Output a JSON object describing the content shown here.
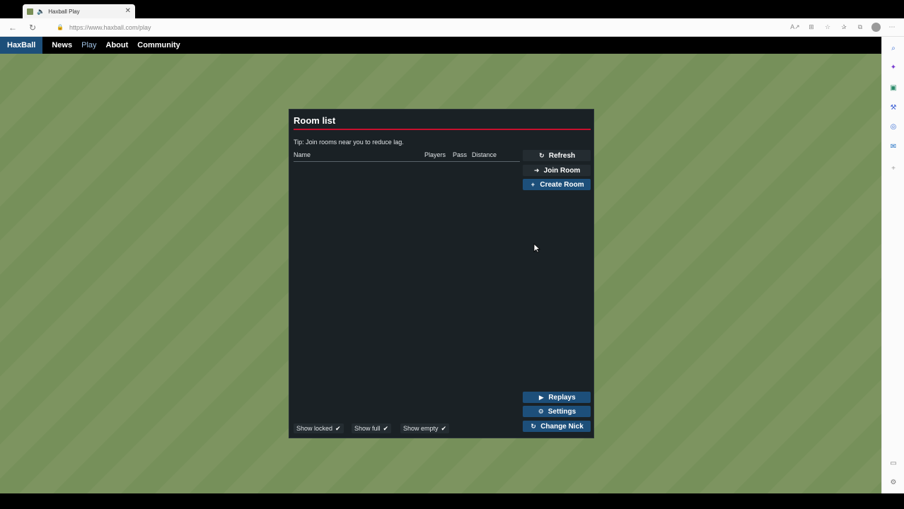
{
  "browser": {
    "tab_title": "Haxball Play",
    "url": "https://www.haxball.com/play"
  },
  "site": {
    "brand": "HaxBall",
    "nav": [
      "News",
      "Play",
      "About",
      "Community"
    ]
  },
  "room_list": {
    "title": "Room list",
    "tip": "Tip: Join rooms near you to reduce lag.",
    "columns": [
      "Name",
      "Players",
      "Pass",
      "Distance"
    ],
    "rooms": [],
    "buttons": {
      "refresh": "Refresh",
      "join": "Join Room",
      "create": "Create Room",
      "replays": "Replays",
      "settings": "Settings",
      "change_nick": "Change Nick"
    },
    "filters": {
      "locked": "Show locked",
      "full": "Show full",
      "empty": "Show empty"
    }
  },
  "colors": {
    "accent_red": "#c8102e",
    "brand_blue": "#1d4f7a",
    "panel": "#1a2125",
    "field": "#7d9460"
  },
  "icons": {
    "refresh": "refresh-icon",
    "join": "sign-in-icon",
    "create": "plus-icon",
    "replays": "play-icon",
    "settings": "gear-icon",
    "change_nick": "refresh-icon"
  }
}
